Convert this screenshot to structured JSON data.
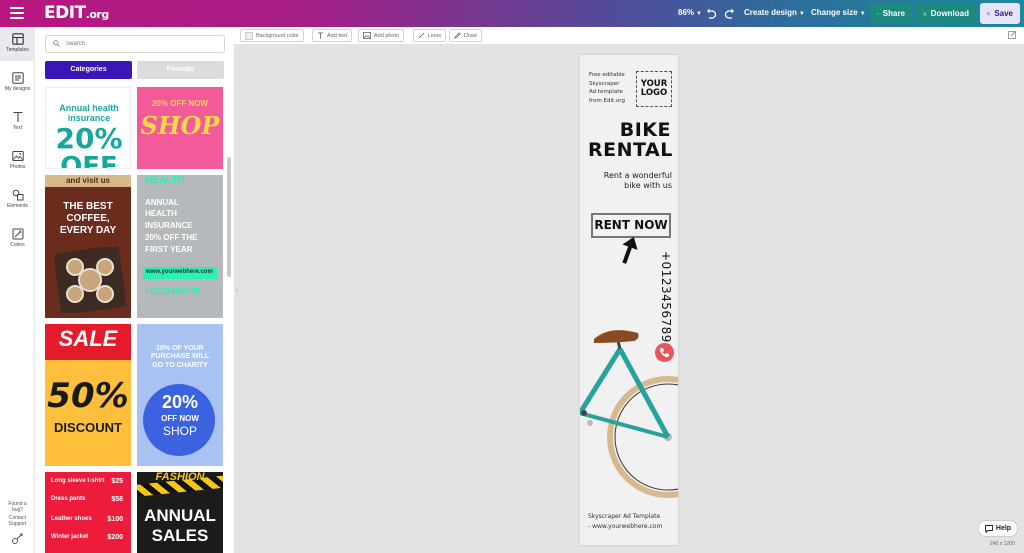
{
  "app": {
    "brand": "EDIT",
    "brand_suffix": ".org",
    "zoom": "86%",
    "create_design": "Create design",
    "change_size": "Change size",
    "share": "Share",
    "download": "Download",
    "save": "Save"
  },
  "rail": {
    "items": [
      {
        "label": "Templates",
        "icon": "template-icon"
      },
      {
        "label": "My designs",
        "icon": "designs-icon"
      },
      {
        "label": "Text",
        "icon": "text-icon"
      },
      {
        "label": "Photos",
        "icon": "image-icon"
      },
      {
        "label": "Elements",
        "icon": "shapes-icon"
      },
      {
        "label": "Colors",
        "icon": "palette-icon"
      }
    ],
    "bug_line1": "Found a",
    "bug_line2": "bug?",
    "support_line1": "Contact",
    "support_line2": "Support"
  },
  "panel": {
    "search_placeholder": "Search",
    "tab_categories": "Categories",
    "tab_formats": "Formats",
    "thumbnails": {
      "t1": {
        "line1": "Annual health",
        "line2": "insurance",
        "big": "20%",
        "big2": "OFF"
      },
      "t2": {
        "line1": "20% OFF NOW",
        "big": "SHOP"
      },
      "t3": {
        "top": "and visit us",
        "line1": "THE BEST",
        "line2": "COFFEE,",
        "line3": "EVERY DAY"
      },
      "t4": {
        "head": "HEALTH",
        "line1": "ANNUAL",
        "line2": "HEALTH",
        "line3": "INSURANCE",
        "line4": "20% OFF THE",
        "line5": "FIRST YEAR",
        "url": "www.yourwebhere.com",
        "phone": "+0123456789"
      },
      "t5": {
        "line1": "SALE",
        "big": "50%",
        "line2": "DISCOUNT"
      },
      "t6": {
        "line1": "10% OF YOUR",
        "line2": "PURCHASE WILL",
        "line3": "GO TO CHARITY",
        "big": "20%",
        "line4": "OFF NOW",
        "line5": "SHOP"
      },
      "t7": {
        "rows": [
          [
            "Long sleeve t-shirt",
            "$25"
          ],
          [
            "Dress pants",
            "$58"
          ],
          [
            "Leather shoes",
            "$100"
          ],
          [
            "Winter jacket",
            "$200"
          ]
        ]
      },
      "t8": {
        "line1": "FASHION",
        "line2": "ANNUAL",
        "line3": "SALES"
      }
    }
  },
  "editor_toolbar": {
    "background_color": "Background color",
    "add_text": "Add text",
    "add_photo": "Add photo",
    "lines": "Lines",
    "draw": "Draw"
  },
  "ad": {
    "intro": "Free editable\nSkyscraper\nAd template\nfrom Edit.org",
    "logo": "YOUR\nLOGO",
    "title1": "BIKE",
    "title2": "RENTAL",
    "tagline": "Rent a wonderful\nbike with us",
    "cta": "RENT NOW",
    "phone": "+01234567890",
    "footer": "Skyscraper Ad Template\n- www.yourwebhere.com"
  },
  "canvas_size": "240 x 1200",
  "help": "Help",
  "colors": {
    "accent_purple": "#3a17b4",
    "teal": "#1d8a7f",
    "magenta": "#b8177f"
  }
}
